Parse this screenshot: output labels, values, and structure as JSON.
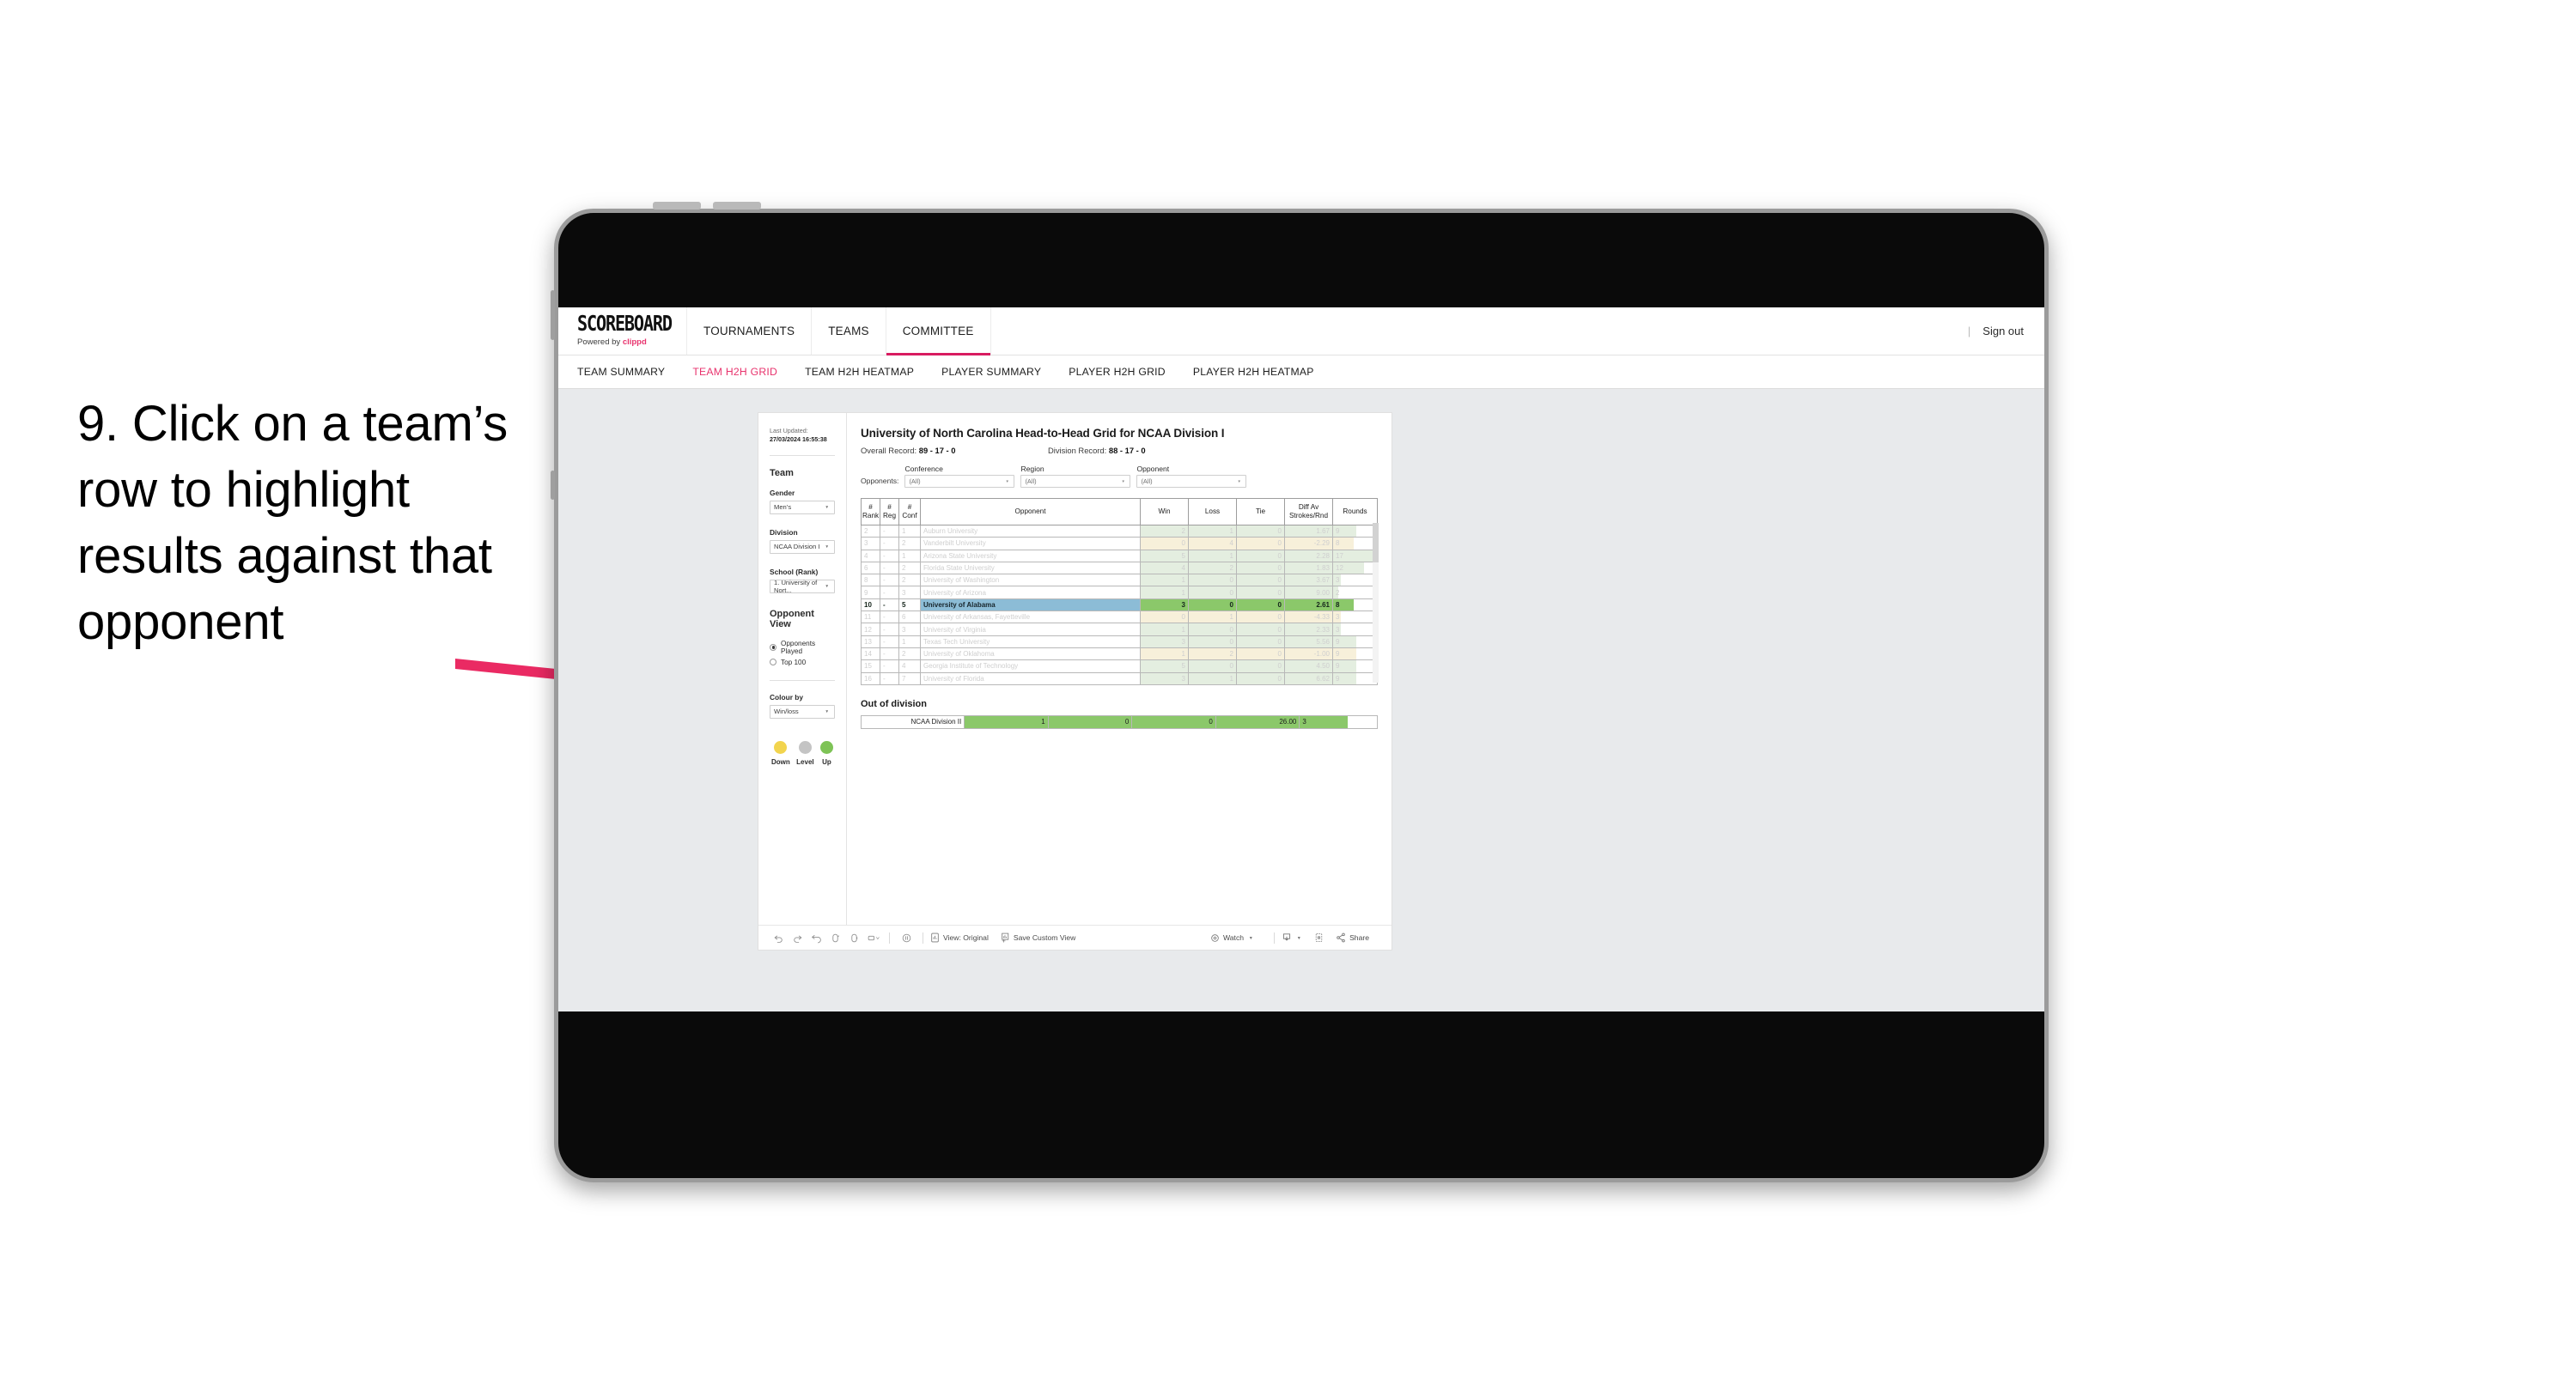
{
  "annotation": {
    "text": "9. Click on a team’s row to highlight results against that opponent",
    "arrow_color": "#ea2a63"
  },
  "app": {
    "logo": {
      "word": "SCOREBOARD",
      "powered_prefix": "Powered by ",
      "powered_brand": "clippd"
    },
    "nav": [
      {
        "label": "TOURNAMENTS",
        "active": false
      },
      {
        "label": "TEAMS",
        "active": false
      },
      {
        "label": "COMMITTEE",
        "active": true
      }
    ],
    "header_right": {
      "divider": "|",
      "signout": "Sign out"
    },
    "subtabs": [
      {
        "label": "TEAM SUMMARY",
        "active": false
      },
      {
        "label": "TEAM H2H GRID",
        "active": true
      },
      {
        "label": "TEAM H2H HEATMAP",
        "active": false
      },
      {
        "label": "PLAYER SUMMARY",
        "active": false
      },
      {
        "label": "PLAYER H2H GRID",
        "active": false
      },
      {
        "label": "PLAYER H2H HEATMAP",
        "active": false
      }
    ],
    "accent": "#e8336d"
  },
  "filters_panel": {
    "last_updated_label": "Last Updated: ",
    "last_updated_value": "27/03/2024 16:55:38",
    "team_heading": "Team",
    "gender": {
      "label": "Gender",
      "value": "Men’s"
    },
    "division": {
      "label": "Division",
      "value": "NCAA Division I"
    },
    "school": {
      "label": "School (Rank)",
      "value": "1. University of Nort..."
    },
    "opponent_view": {
      "heading": "Opponent View",
      "options": [
        {
          "label": "Opponents Played",
          "selected": true
        },
        {
          "label": "Top 100",
          "selected": false
        }
      ]
    },
    "colour_by": {
      "label": "Colour by",
      "value": "Win/loss"
    },
    "legend": [
      {
        "label": "Down",
        "color": "#f2d44e"
      },
      {
        "label": "Level",
        "color": "#c4c4c4"
      },
      {
        "label": "Up",
        "color": "#7ec356"
      }
    ]
  },
  "main": {
    "title": "University of North Carolina Head-to-Head Grid for NCAA Division I",
    "overall_label": "Overall Record: ",
    "overall_value": "89 - 17 - 0",
    "division_label": "Division Record: ",
    "division_value": "88 - 17 - 0",
    "opponents_lead": "Opponents:",
    "filters": [
      {
        "caption": "Conference",
        "value": "(All)"
      },
      {
        "caption": "Region",
        "value": "(All)"
      },
      {
        "caption": "Opponent",
        "value": "(All)"
      }
    ],
    "columns": [
      "# Rank",
      "# Reg",
      "# Conf",
      "Opponent",
      "Win",
      "Loss",
      "Tie",
      "Diff Av Strokes/Rnd",
      "Rounds"
    ],
    "columns_split": [
      [
        "#",
        "Rank"
      ],
      [
        "#",
        "Reg"
      ],
      [
        "#",
        "Conf"
      ],
      [
        "Opponent",
        ""
      ],
      [
        "Win",
        ""
      ],
      [
        "Loss",
        ""
      ],
      [
        "Tie",
        ""
      ],
      [
        "Diff Av",
        "Strokes/Rnd"
      ],
      [
        "Rounds",
        ""
      ]
    ],
    "out_of_division_title": "Out of division",
    "out_of_division_row": {
      "label": "NCAA Division II",
      "win": "1",
      "loss": "0",
      "tie": "0",
      "diff": "26.00",
      "rounds": "3",
      "color": "#8bc86a"
    }
  },
  "chart_data": {
    "type": "table",
    "title": "University of North Carolina Head-to-Head Grid for NCAA Division I",
    "columns": [
      "# Rank",
      "# Reg",
      "# Conf",
      "Opponent",
      "Win",
      "Loss",
      "Tie",
      "Diff Av Strokes/Rnd",
      "Rounds"
    ],
    "rows": [
      {
        "rank": "2",
        "reg": "-",
        "conf": "1",
        "opponent": "Auburn University",
        "win": "2",
        "loss": "1",
        "tie": "0",
        "diff": "1.67",
        "rounds": "9",
        "tone": "up",
        "selected": false
      },
      {
        "rank": "3",
        "reg": "-",
        "conf": "2",
        "opponent": "Vanderbilt University",
        "win": "0",
        "loss": "4",
        "tie": "0",
        "diff": "-2.29",
        "rounds": "8",
        "tone": "down",
        "selected": false
      },
      {
        "rank": "4",
        "reg": "-",
        "conf": "1",
        "opponent": "Arizona State University",
        "win": "5",
        "loss": "1",
        "tie": "0",
        "diff": "2.28",
        "rounds": "17",
        "tone": "up",
        "selected": false
      },
      {
        "rank": "6",
        "reg": "-",
        "conf": "2",
        "opponent": "Florida State University",
        "win": "4",
        "loss": "2",
        "tie": "0",
        "diff": "1.83",
        "rounds": "12",
        "tone": "up",
        "selected": false
      },
      {
        "rank": "8",
        "reg": "-",
        "conf": "2",
        "opponent": "University of Washington",
        "win": "1",
        "loss": "0",
        "tie": "0",
        "diff": "3.67",
        "rounds": "3",
        "tone": "up",
        "selected": false
      },
      {
        "rank": "9",
        "reg": "-",
        "conf": "3",
        "opponent": "University of Arizona",
        "win": "1",
        "loss": "0",
        "tie": "0",
        "diff": "9.00",
        "rounds": "2",
        "tone": "up",
        "selected": false
      },
      {
        "rank": "10",
        "reg": "-",
        "conf": "5",
        "opponent": "University of Alabama",
        "win": "3",
        "loss": "0",
        "tie": "0",
        "diff": "2.61",
        "rounds": "8",
        "tone": "up",
        "selected": true
      },
      {
        "rank": "11",
        "reg": "-",
        "conf": "6",
        "opponent": "University of Arkansas, Fayetteville",
        "win": "0",
        "loss": "1",
        "tie": "0",
        "diff": "-4.33",
        "rounds": "3",
        "tone": "down",
        "selected": false
      },
      {
        "rank": "12",
        "reg": "-",
        "conf": "3",
        "opponent": "University of Virginia",
        "win": "1",
        "loss": "0",
        "tie": "0",
        "diff": "2.33",
        "rounds": "3",
        "tone": "up",
        "selected": false
      },
      {
        "rank": "13",
        "reg": "-",
        "conf": "1",
        "opponent": "Texas Tech University",
        "win": "3",
        "loss": "0",
        "tie": "0",
        "diff": "5.56",
        "rounds": "9",
        "tone": "up",
        "selected": false
      },
      {
        "rank": "14",
        "reg": "-",
        "conf": "2",
        "opponent": "University of Oklahoma",
        "win": "1",
        "loss": "2",
        "tie": "0",
        "diff": "-1.00",
        "rounds": "9",
        "tone": "down",
        "selected": false
      },
      {
        "rank": "15",
        "reg": "-",
        "conf": "4",
        "opponent": "Georgia Institute of Technology",
        "win": "5",
        "loss": "0",
        "tie": "0",
        "diff": "4.50",
        "rounds": "9",
        "tone": "up",
        "selected": false
      },
      {
        "rank": "16",
        "reg": "-",
        "conf": "7",
        "opponent": "University of Florida",
        "win": "3",
        "loss": "1",
        "tie": "0",
        "diff": "6.62",
        "rounds": "9",
        "tone": "up",
        "selected": false
      }
    ],
    "out_of_division": [
      {
        "label": "NCAA Division II",
        "win": "1",
        "loss": "0",
        "tie": "0",
        "diff": "26.00",
        "rounds": "3"
      }
    ],
    "rounds_max": 17,
    "colors": {
      "up": "#e4eee0",
      "down": "#f7f0da",
      "selected_fill": "#8bc86a",
      "selected_opponent": "#8cbcd6"
    }
  },
  "toolbar": {
    "view_label": "View: Original",
    "save_label": "Save Custom View",
    "watch_label": "Watch",
    "share_label": "Share"
  }
}
